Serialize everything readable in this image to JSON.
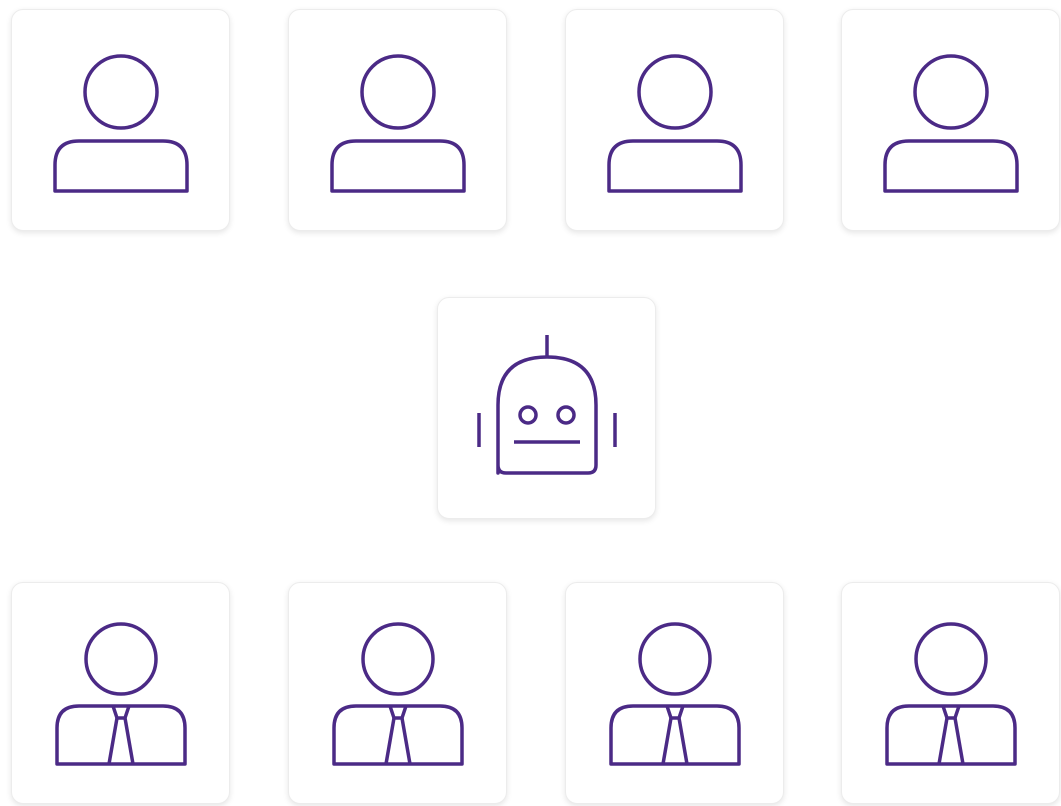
{
  "colors": {
    "icon_stroke": "#4b2a86",
    "card_background": "#ffffff",
    "card_border": "#ececec"
  },
  "top_row": {
    "icons": [
      "user-icon",
      "user-icon",
      "user-icon",
      "user-icon"
    ]
  },
  "middle": {
    "icon": "robot-icon"
  },
  "bottom_row": {
    "icons": [
      "businessman-icon",
      "businessman-icon",
      "businessman-icon",
      "businessman-icon"
    ]
  }
}
